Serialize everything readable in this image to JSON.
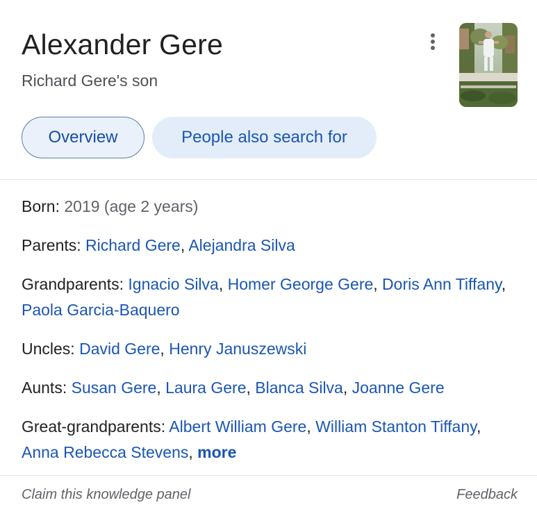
{
  "header": {
    "title": "Alexander Gere",
    "subtitle": "Richard Gere's son"
  },
  "chips": {
    "overview": "Overview",
    "people": "People also search for"
  },
  "facts": {
    "born": {
      "label": "Born:",
      "value": "2019 (age 2 years)"
    },
    "parents": {
      "label": "Parents:",
      "links": [
        "Richard Gere",
        "Alejandra Silva"
      ]
    },
    "grandparents": {
      "label": "Grandparents:",
      "links": [
        "Ignacio Silva",
        "Homer George Gere",
        "Doris Ann Tiffany",
        "Paola Garcia-Baquero"
      ]
    },
    "uncles": {
      "label": "Uncles:",
      "links": [
        "David Gere",
        "Henry Januszewski"
      ]
    },
    "aunts": {
      "label": "Aunts:",
      "links": [
        "Susan Gere",
        "Laura Gere",
        "Blanca Silva",
        "Joanne Gere"
      ]
    },
    "great_grandparents": {
      "label": "Great-grandparents:",
      "links": [
        "Albert William Gere",
        "William Stanton Tiffany",
        "Anna Rebecca Stevens"
      ],
      "more": "more"
    }
  },
  "footer": {
    "claim": "Claim this knowledge panel",
    "feedback": "Feedback"
  },
  "icons": {
    "menu": "more-vert-icon"
  },
  "colors": {
    "link": "#1a56b4",
    "chip_bg": "#e3edfa",
    "text": "#202124",
    "muted": "#5f6368"
  }
}
